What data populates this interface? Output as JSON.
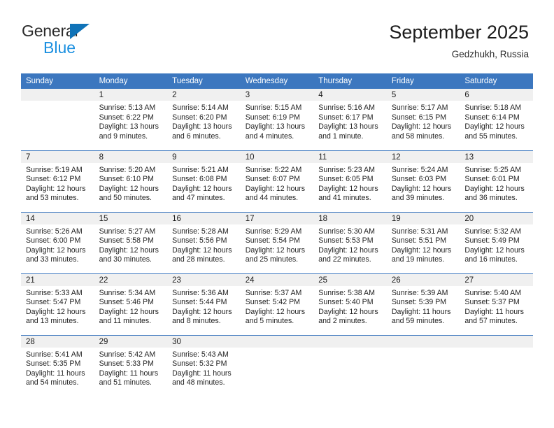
{
  "brand": {
    "name_part1": "General",
    "name_part2": "Blue",
    "triangle_color": "#1073b8",
    "blue_color": "#1a8fe0"
  },
  "header": {
    "month_title": "September 2025",
    "location": "Gedzhukh, Russia",
    "header_bg_color": "#3c77bf"
  },
  "weekdays": [
    "Sunday",
    "Monday",
    "Tuesday",
    "Wednesday",
    "Thursday",
    "Friday",
    "Saturday"
  ],
  "weeks": [
    [
      {
        "day": "",
        "sunrise": "",
        "sunset": "",
        "daylight": "",
        "empty": true
      },
      {
        "day": "1",
        "sunrise": "Sunrise: 5:13 AM",
        "sunset": "Sunset: 6:22 PM",
        "daylight": "Daylight: 13 hours and 9 minutes."
      },
      {
        "day": "2",
        "sunrise": "Sunrise: 5:14 AM",
        "sunset": "Sunset: 6:20 PM",
        "daylight": "Daylight: 13 hours and 6 minutes."
      },
      {
        "day": "3",
        "sunrise": "Sunrise: 5:15 AM",
        "sunset": "Sunset: 6:19 PM",
        "daylight": "Daylight: 13 hours and 4 minutes."
      },
      {
        "day": "4",
        "sunrise": "Sunrise: 5:16 AM",
        "sunset": "Sunset: 6:17 PM",
        "daylight": "Daylight: 13 hours and 1 minute."
      },
      {
        "day": "5",
        "sunrise": "Sunrise: 5:17 AM",
        "sunset": "Sunset: 6:15 PM",
        "daylight": "Daylight: 12 hours and 58 minutes."
      },
      {
        "day": "6",
        "sunrise": "Sunrise: 5:18 AM",
        "sunset": "Sunset: 6:14 PM",
        "daylight": "Daylight: 12 hours and 55 minutes."
      }
    ],
    [
      {
        "day": "7",
        "sunrise": "Sunrise: 5:19 AM",
        "sunset": "Sunset: 6:12 PM",
        "daylight": "Daylight: 12 hours and 53 minutes."
      },
      {
        "day": "8",
        "sunrise": "Sunrise: 5:20 AM",
        "sunset": "Sunset: 6:10 PM",
        "daylight": "Daylight: 12 hours and 50 minutes."
      },
      {
        "day": "9",
        "sunrise": "Sunrise: 5:21 AM",
        "sunset": "Sunset: 6:08 PM",
        "daylight": "Daylight: 12 hours and 47 minutes."
      },
      {
        "day": "10",
        "sunrise": "Sunrise: 5:22 AM",
        "sunset": "Sunset: 6:07 PM",
        "daylight": "Daylight: 12 hours and 44 minutes."
      },
      {
        "day": "11",
        "sunrise": "Sunrise: 5:23 AM",
        "sunset": "Sunset: 6:05 PM",
        "daylight": "Daylight: 12 hours and 41 minutes."
      },
      {
        "day": "12",
        "sunrise": "Sunrise: 5:24 AM",
        "sunset": "Sunset: 6:03 PM",
        "daylight": "Daylight: 12 hours and 39 minutes."
      },
      {
        "day": "13",
        "sunrise": "Sunrise: 5:25 AM",
        "sunset": "Sunset: 6:01 PM",
        "daylight": "Daylight: 12 hours and 36 minutes."
      }
    ],
    [
      {
        "day": "14",
        "sunrise": "Sunrise: 5:26 AM",
        "sunset": "Sunset: 6:00 PM",
        "daylight": "Daylight: 12 hours and 33 minutes."
      },
      {
        "day": "15",
        "sunrise": "Sunrise: 5:27 AM",
        "sunset": "Sunset: 5:58 PM",
        "daylight": "Daylight: 12 hours and 30 minutes."
      },
      {
        "day": "16",
        "sunrise": "Sunrise: 5:28 AM",
        "sunset": "Sunset: 5:56 PM",
        "daylight": "Daylight: 12 hours and 28 minutes."
      },
      {
        "day": "17",
        "sunrise": "Sunrise: 5:29 AM",
        "sunset": "Sunset: 5:54 PM",
        "daylight": "Daylight: 12 hours and 25 minutes."
      },
      {
        "day": "18",
        "sunrise": "Sunrise: 5:30 AM",
        "sunset": "Sunset: 5:53 PM",
        "daylight": "Daylight: 12 hours and 22 minutes."
      },
      {
        "day": "19",
        "sunrise": "Sunrise: 5:31 AM",
        "sunset": "Sunset: 5:51 PM",
        "daylight": "Daylight: 12 hours and 19 minutes."
      },
      {
        "day": "20",
        "sunrise": "Sunrise: 5:32 AM",
        "sunset": "Sunset: 5:49 PM",
        "daylight": "Daylight: 12 hours and 16 minutes."
      }
    ],
    [
      {
        "day": "21",
        "sunrise": "Sunrise: 5:33 AM",
        "sunset": "Sunset: 5:47 PM",
        "daylight": "Daylight: 12 hours and 13 minutes."
      },
      {
        "day": "22",
        "sunrise": "Sunrise: 5:34 AM",
        "sunset": "Sunset: 5:46 PM",
        "daylight": "Daylight: 12 hours and 11 minutes."
      },
      {
        "day": "23",
        "sunrise": "Sunrise: 5:36 AM",
        "sunset": "Sunset: 5:44 PM",
        "daylight": "Daylight: 12 hours and 8 minutes."
      },
      {
        "day": "24",
        "sunrise": "Sunrise: 5:37 AM",
        "sunset": "Sunset: 5:42 PM",
        "daylight": "Daylight: 12 hours and 5 minutes."
      },
      {
        "day": "25",
        "sunrise": "Sunrise: 5:38 AM",
        "sunset": "Sunset: 5:40 PM",
        "daylight": "Daylight: 12 hours and 2 minutes."
      },
      {
        "day": "26",
        "sunrise": "Sunrise: 5:39 AM",
        "sunset": "Sunset: 5:39 PM",
        "daylight": "Daylight: 11 hours and 59 minutes."
      },
      {
        "day": "27",
        "sunrise": "Sunrise: 5:40 AM",
        "sunset": "Sunset: 5:37 PM",
        "daylight": "Daylight: 11 hours and 57 minutes."
      }
    ],
    [
      {
        "day": "28",
        "sunrise": "Sunrise: 5:41 AM",
        "sunset": "Sunset: 5:35 PM",
        "daylight": "Daylight: 11 hours and 54 minutes."
      },
      {
        "day": "29",
        "sunrise": "Sunrise: 5:42 AM",
        "sunset": "Sunset: 5:33 PM",
        "daylight": "Daylight: 11 hours and 51 minutes."
      },
      {
        "day": "30",
        "sunrise": "Sunrise: 5:43 AM",
        "sunset": "Sunset: 5:32 PM",
        "daylight": "Daylight: 11 hours and 48 minutes."
      },
      {
        "day": "",
        "sunrise": "",
        "sunset": "",
        "daylight": "",
        "empty": true
      },
      {
        "day": "",
        "sunrise": "",
        "sunset": "",
        "daylight": "",
        "empty": true
      },
      {
        "day": "",
        "sunrise": "",
        "sunset": "",
        "daylight": "",
        "empty": true
      },
      {
        "day": "",
        "sunrise": "",
        "sunset": "",
        "daylight": "",
        "empty": true
      }
    ]
  ]
}
